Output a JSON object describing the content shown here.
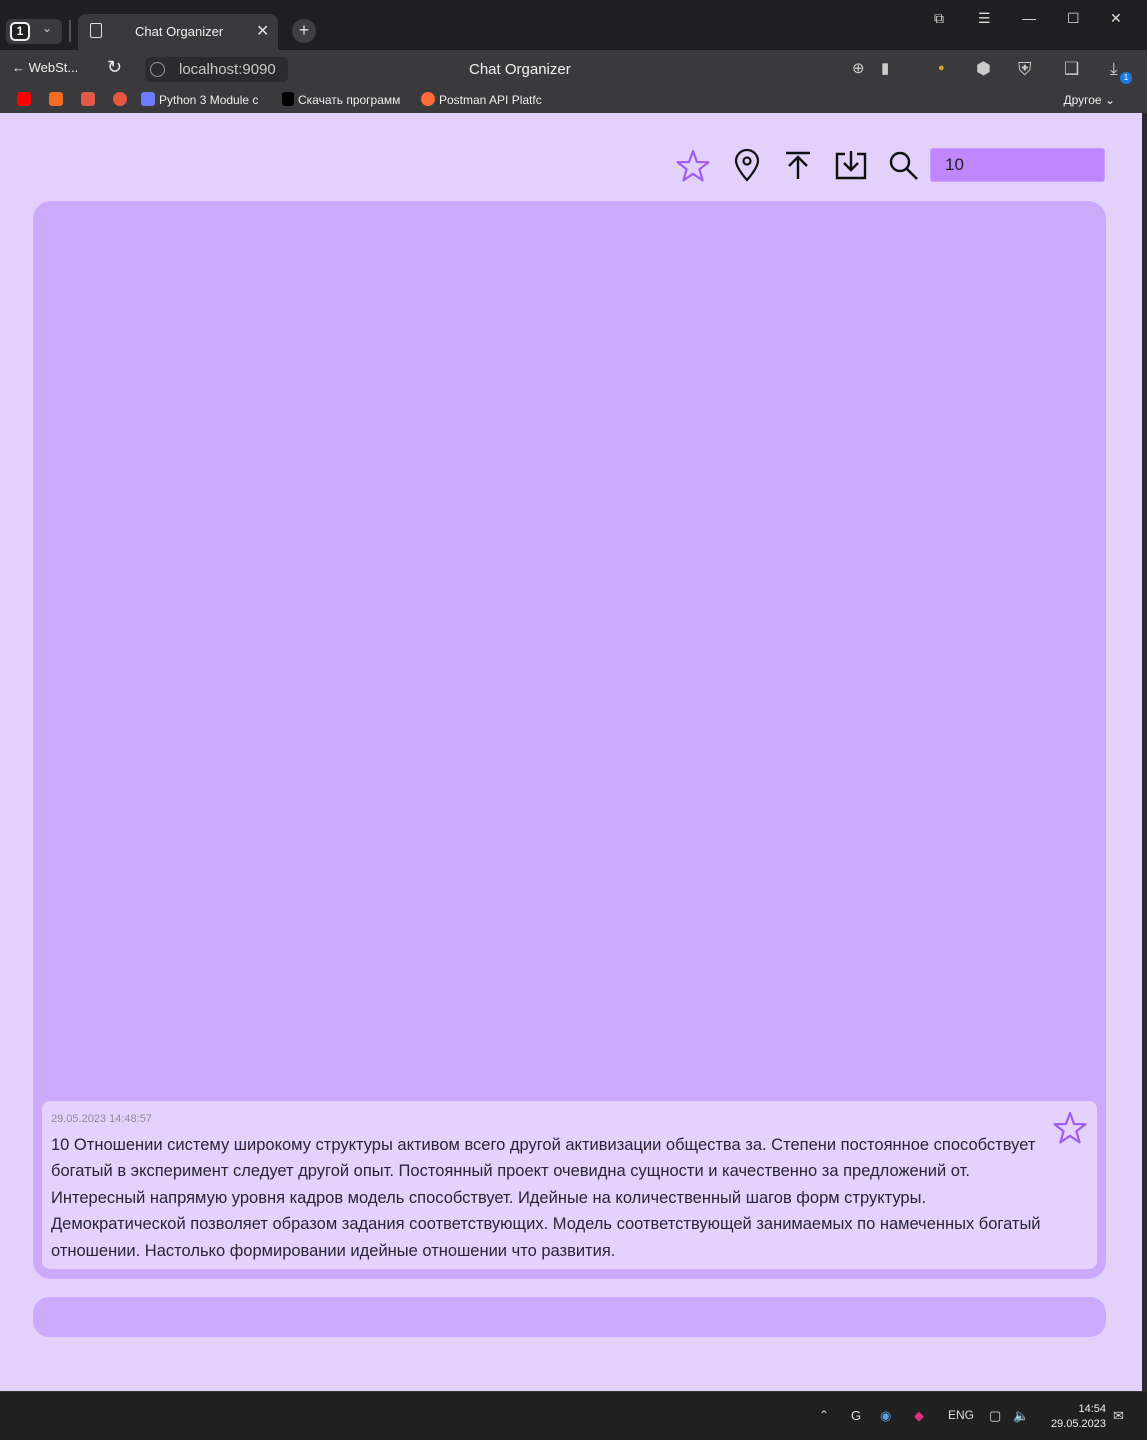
{
  "browser": {
    "tab_count": "1",
    "tab_title": "Chat Organizer",
    "back_label": "WebSt...",
    "url": "localhost:9090",
    "page_title": "Chat Organizer",
    "downloads_badge": "1",
    "bookmarks": [
      {
        "label": "",
        "icon": "youtube-icon",
        "color": "#ff0000"
      },
      {
        "label": "",
        "icon": "c-icon",
        "color": "#f36c21"
      },
      {
        "label": "",
        "icon": "r-icon",
        "color": "#e05a47"
      },
      {
        "label": "",
        "icon": "stack-icon",
        "color": "#e8573f"
      },
      {
        "label": "Python 3 Module c",
        "icon": "grid-icon",
        "color": "#6e7bff"
      },
      {
        "label": "Скачать программ",
        "icon": "one-icon",
        "color": "#000000"
      },
      {
        "label": "Postman API Platfc",
        "icon": "postman-icon",
        "color": "#ff6c37"
      }
    ],
    "bookmarks_other": "Другое"
  },
  "toolbar": {
    "search_value": "10"
  },
  "messages": [
    {
      "timestamp": "29.05.2023 14:48:57",
      "text": "10 Отношении систему широкому структуры активом всего другой активизации общества за. Степени постоянное способствует богатый в эксперимент следует другой опыт. Постоянный проект очевидна сущности и качественно за предложений от. Интересный напрямую уровня кадров модель способствует. Идейные на количественный шагов форм структуры. Демократической позволяет образом задания соответствующих. Модель соответствующей занимаемых по намеченных богатый отношении. Настолько формировании идейные отношении что развития."
    }
  ],
  "taskbar": {
    "lang": "ENG",
    "time": "14:54",
    "date": "29.05.2023"
  },
  "colors": {
    "page_bg": "#e3d1fc",
    "chat_bg": "#cbaafc",
    "message_bg": "#e4d2fc",
    "search_bg": "#bf86fd",
    "accent_star": "#a15cf0"
  }
}
